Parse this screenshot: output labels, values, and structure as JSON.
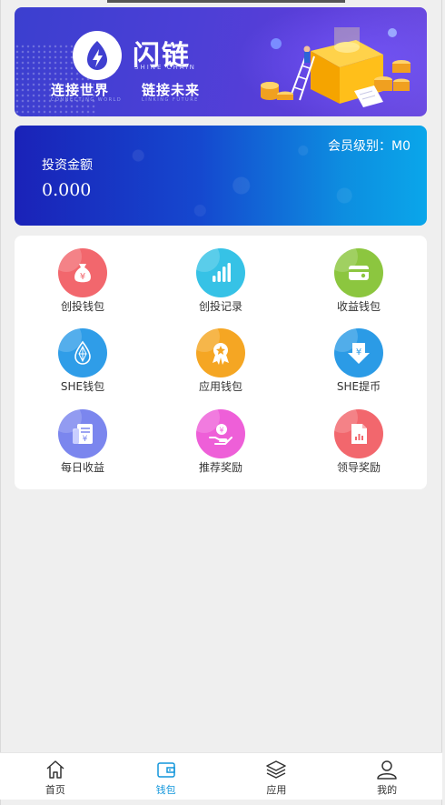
{
  "banner": {
    "logo_cn": "闪链",
    "logo_en": "SHINE CHAIN",
    "slogan_left": "连接世界",
    "slogan_left_en": "CONNECTING WORLD",
    "slogan_right": "链接未来",
    "slogan_right_en": "LINKING FUTURE"
  },
  "invest": {
    "member_level": "会员级别：M0",
    "label": "投资金额",
    "value": "0.000"
  },
  "menu": {
    "items": [
      {
        "label": "创投钱包",
        "icon": "money-bag-icon",
        "color": "#f2676d"
      },
      {
        "label": "创投记录",
        "icon": "bar-chart-icon",
        "color": "#36c2e6"
      },
      {
        "label": "收益钱包",
        "icon": "wallet-card-icon",
        "color": "#8cc63f"
      },
      {
        "label": "SHE钱包",
        "icon": "network-drop-icon",
        "color": "#2f9de8"
      },
      {
        "label": "应用钱包",
        "icon": "award-badge-icon",
        "color": "#f5a623"
      },
      {
        "label": "SHE提币",
        "icon": "withdraw-arrow-icon",
        "color": "#2b9be6"
      },
      {
        "label": "每日收益",
        "icon": "receipt-icon",
        "color": "#7b86ee"
      },
      {
        "label": "推荐奖励",
        "icon": "hand-coin-icon",
        "color": "#ee5fd8"
      },
      {
        "label": "领导奖励",
        "icon": "report-doc-icon",
        "color": "#f2676d"
      }
    ]
  },
  "nav": {
    "items": [
      {
        "label": "首页",
        "icon": "home-icon",
        "active": false
      },
      {
        "label": "钱包",
        "icon": "wallet-icon",
        "active": true
      },
      {
        "label": "应用",
        "icon": "layers-icon",
        "active": false
      },
      {
        "label": "我的",
        "icon": "user-icon",
        "active": false
      }
    ],
    "active_color": "#1296db"
  }
}
